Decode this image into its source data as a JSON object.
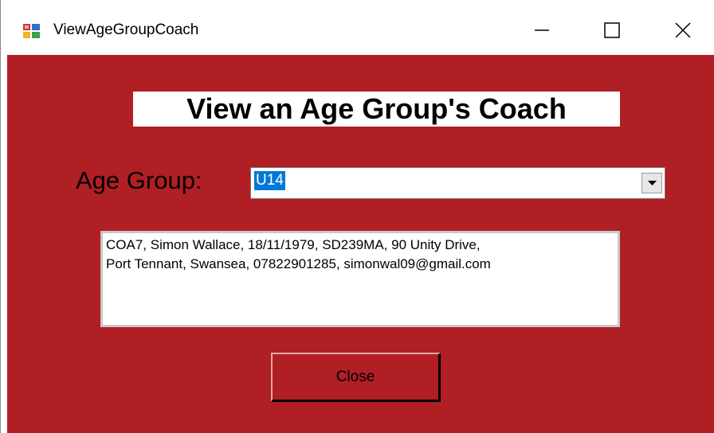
{
  "window": {
    "title": "ViewAgeGroupCoach",
    "icon": "winforms-app-icon",
    "controls": {
      "minimize_icon": "minimize-icon",
      "maximize_icon": "maximize-icon",
      "close_icon": "close-icon"
    }
  },
  "form": {
    "heading": "View an Age Group's Coach",
    "age_group_label": "Age Group:",
    "age_group_selected": "U14",
    "coach_details": "COA7, Simon Wallace, 18/11/1979, SD239MA, 90 Unity Drive,\nPort Tennant, Swansea, 07822901285, simonwal09@gmail.com",
    "close_button_label": "Close"
  },
  "colors": {
    "form_background": "#b01f24",
    "selection_highlight": "#0078d7"
  }
}
